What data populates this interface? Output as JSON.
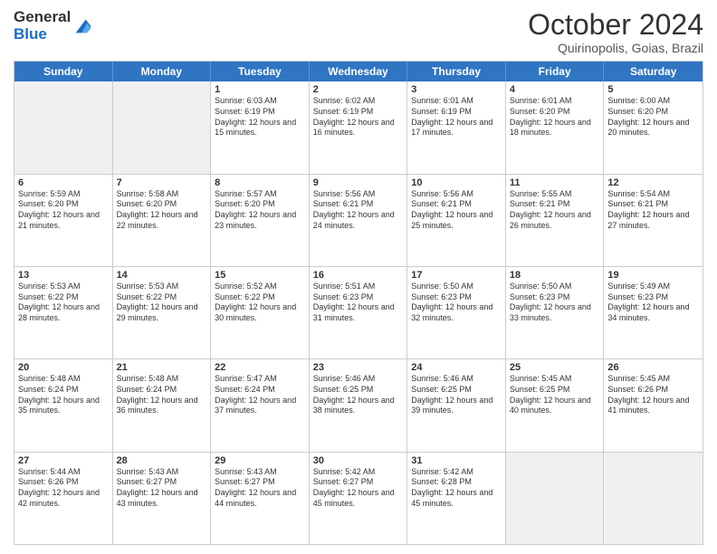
{
  "logo": {
    "general": "General",
    "blue": "Blue"
  },
  "title": "October 2024",
  "location": "Quirinopolis, Goias, Brazil",
  "header_days": [
    "Sunday",
    "Monday",
    "Tuesday",
    "Wednesday",
    "Thursday",
    "Friday",
    "Saturday"
  ],
  "weeks": [
    [
      {
        "day": "",
        "info": ""
      },
      {
        "day": "",
        "info": ""
      },
      {
        "day": "1",
        "info": "Sunrise: 6:03 AM\nSunset: 6:19 PM\nDaylight: 12 hours and 15 minutes."
      },
      {
        "day": "2",
        "info": "Sunrise: 6:02 AM\nSunset: 6:19 PM\nDaylight: 12 hours and 16 minutes."
      },
      {
        "day": "3",
        "info": "Sunrise: 6:01 AM\nSunset: 6:19 PM\nDaylight: 12 hours and 17 minutes."
      },
      {
        "day": "4",
        "info": "Sunrise: 6:01 AM\nSunset: 6:20 PM\nDaylight: 12 hours and 18 minutes."
      },
      {
        "day": "5",
        "info": "Sunrise: 6:00 AM\nSunset: 6:20 PM\nDaylight: 12 hours and 20 minutes."
      }
    ],
    [
      {
        "day": "6",
        "info": "Sunrise: 5:59 AM\nSunset: 6:20 PM\nDaylight: 12 hours and 21 minutes."
      },
      {
        "day": "7",
        "info": "Sunrise: 5:58 AM\nSunset: 6:20 PM\nDaylight: 12 hours and 22 minutes."
      },
      {
        "day": "8",
        "info": "Sunrise: 5:57 AM\nSunset: 6:20 PM\nDaylight: 12 hours and 23 minutes."
      },
      {
        "day": "9",
        "info": "Sunrise: 5:56 AM\nSunset: 6:21 PM\nDaylight: 12 hours and 24 minutes."
      },
      {
        "day": "10",
        "info": "Sunrise: 5:56 AM\nSunset: 6:21 PM\nDaylight: 12 hours and 25 minutes."
      },
      {
        "day": "11",
        "info": "Sunrise: 5:55 AM\nSunset: 6:21 PM\nDaylight: 12 hours and 26 minutes."
      },
      {
        "day": "12",
        "info": "Sunrise: 5:54 AM\nSunset: 6:21 PM\nDaylight: 12 hours and 27 minutes."
      }
    ],
    [
      {
        "day": "13",
        "info": "Sunrise: 5:53 AM\nSunset: 6:22 PM\nDaylight: 12 hours and 28 minutes."
      },
      {
        "day": "14",
        "info": "Sunrise: 5:53 AM\nSunset: 6:22 PM\nDaylight: 12 hours and 29 minutes."
      },
      {
        "day": "15",
        "info": "Sunrise: 5:52 AM\nSunset: 6:22 PM\nDaylight: 12 hours and 30 minutes."
      },
      {
        "day": "16",
        "info": "Sunrise: 5:51 AM\nSunset: 6:23 PM\nDaylight: 12 hours and 31 minutes."
      },
      {
        "day": "17",
        "info": "Sunrise: 5:50 AM\nSunset: 6:23 PM\nDaylight: 12 hours and 32 minutes."
      },
      {
        "day": "18",
        "info": "Sunrise: 5:50 AM\nSunset: 6:23 PM\nDaylight: 12 hours and 33 minutes."
      },
      {
        "day": "19",
        "info": "Sunrise: 5:49 AM\nSunset: 6:23 PM\nDaylight: 12 hours and 34 minutes."
      }
    ],
    [
      {
        "day": "20",
        "info": "Sunrise: 5:48 AM\nSunset: 6:24 PM\nDaylight: 12 hours and 35 minutes."
      },
      {
        "day": "21",
        "info": "Sunrise: 5:48 AM\nSunset: 6:24 PM\nDaylight: 12 hours and 36 minutes."
      },
      {
        "day": "22",
        "info": "Sunrise: 5:47 AM\nSunset: 6:24 PM\nDaylight: 12 hours and 37 minutes."
      },
      {
        "day": "23",
        "info": "Sunrise: 5:46 AM\nSunset: 6:25 PM\nDaylight: 12 hours and 38 minutes."
      },
      {
        "day": "24",
        "info": "Sunrise: 5:46 AM\nSunset: 6:25 PM\nDaylight: 12 hours and 39 minutes."
      },
      {
        "day": "25",
        "info": "Sunrise: 5:45 AM\nSunset: 6:25 PM\nDaylight: 12 hours and 40 minutes."
      },
      {
        "day": "26",
        "info": "Sunrise: 5:45 AM\nSunset: 6:26 PM\nDaylight: 12 hours and 41 minutes."
      }
    ],
    [
      {
        "day": "27",
        "info": "Sunrise: 5:44 AM\nSunset: 6:26 PM\nDaylight: 12 hours and 42 minutes."
      },
      {
        "day": "28",
        "info": "Sunrise: 5:43 AM\nSunset: 6:27 PM\nDaylight: 12 hours and 43 minutes."
      },
      {
        "day": "29",
        "info": "Sunrise: 5:43 AM\nSunset: 6:27 PM\nDaylight: 12 hours and 44 minutes."
      },
      {
        "day": "30",
        "info": "Sunrise: 5:42 AM\nSunset: 6:27 PM\nDaylight: 12 hours and 45 minutes."
      },
      {
        "day": "31",
        "info": "Sunrise: 5:42 AM\nSunset: 6:28 PM\nDaylight: 12 hours and 45 minutes."
      },
      {
        "day": "",
        "info": ""
      },
      {
        "day": "",
        "info": ""
      }
    ]
  ],
  "colors": {
    "header_bg": "#2f75c3",
    "header_text": "#ffffff",
    "border": "#cccccc",
    "shaded": "#f0f0f0"
  }
}
